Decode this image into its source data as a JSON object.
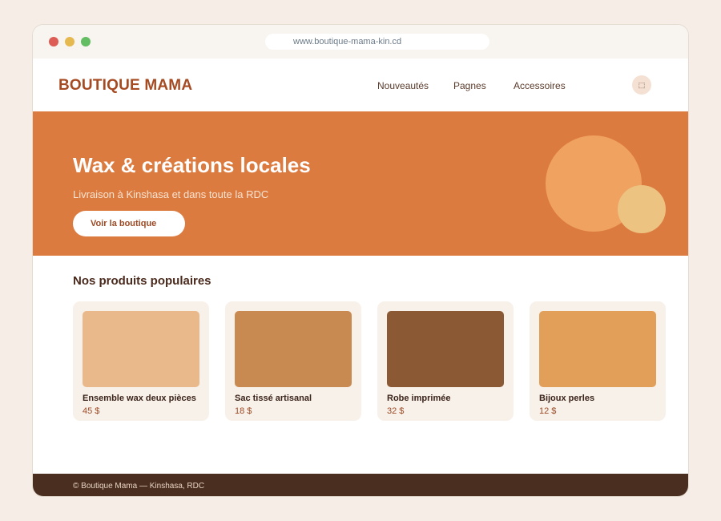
{
  "colors": {
    "page_bg": "#f6eee6",
    "brand": "#a64a22",
    "hero_bg": "#dc7b3f",
    "hero_circle_big": "#f0a260",
    "hero_circle_small": "#edc382",
    "footer_bg": "#4a2e1f",
    "dot_red": "#dd5c55",
    "dot_yellow": "#e6b950",
    "dot_green": "#63bd62"
  },
  "browser": {
    "url": "www.boutique-mama-kin.cd"
  },
  "header": {
    "logo": "BOUTIQUE MAMA",
    "nav": [
      "Nouveautés",
      "Pagnes",
      "Accessoires"
    ],
    "cart_icon": "cart-icon",
    "cart_glyph": "⬚"
  },
  "hero": {
    "title": "Wax & créations locales",
    "subtitle": "Livraison à Kinshasa et dans toute la RDC",
    "cta": "Voir la boutique"
  },
  "products": {
    "heading": "Nos produits populaires",
    "items": [
      {
        "name": "Ensemble wax deux pièces",
        "price": "45 $",
        "swatch": "#e9b98b"
      },
      {
        "name": "Sac tissé artisanal",
        "price": "18 $",
        "swatch": "#c98a52"
      },
      {
        "name": "Robe imprimée",
        "price": "32 $",
        "swatch": "#8b5a34"
      },
      {
        "name": "Bijoux perles",
        "price": "12 $",
        "swatch": "#e19f5a"
      }
    ]
  },
  "footer": {
    "text": "© Boutique Mama — Kinshasa, RDC"
  }
}
